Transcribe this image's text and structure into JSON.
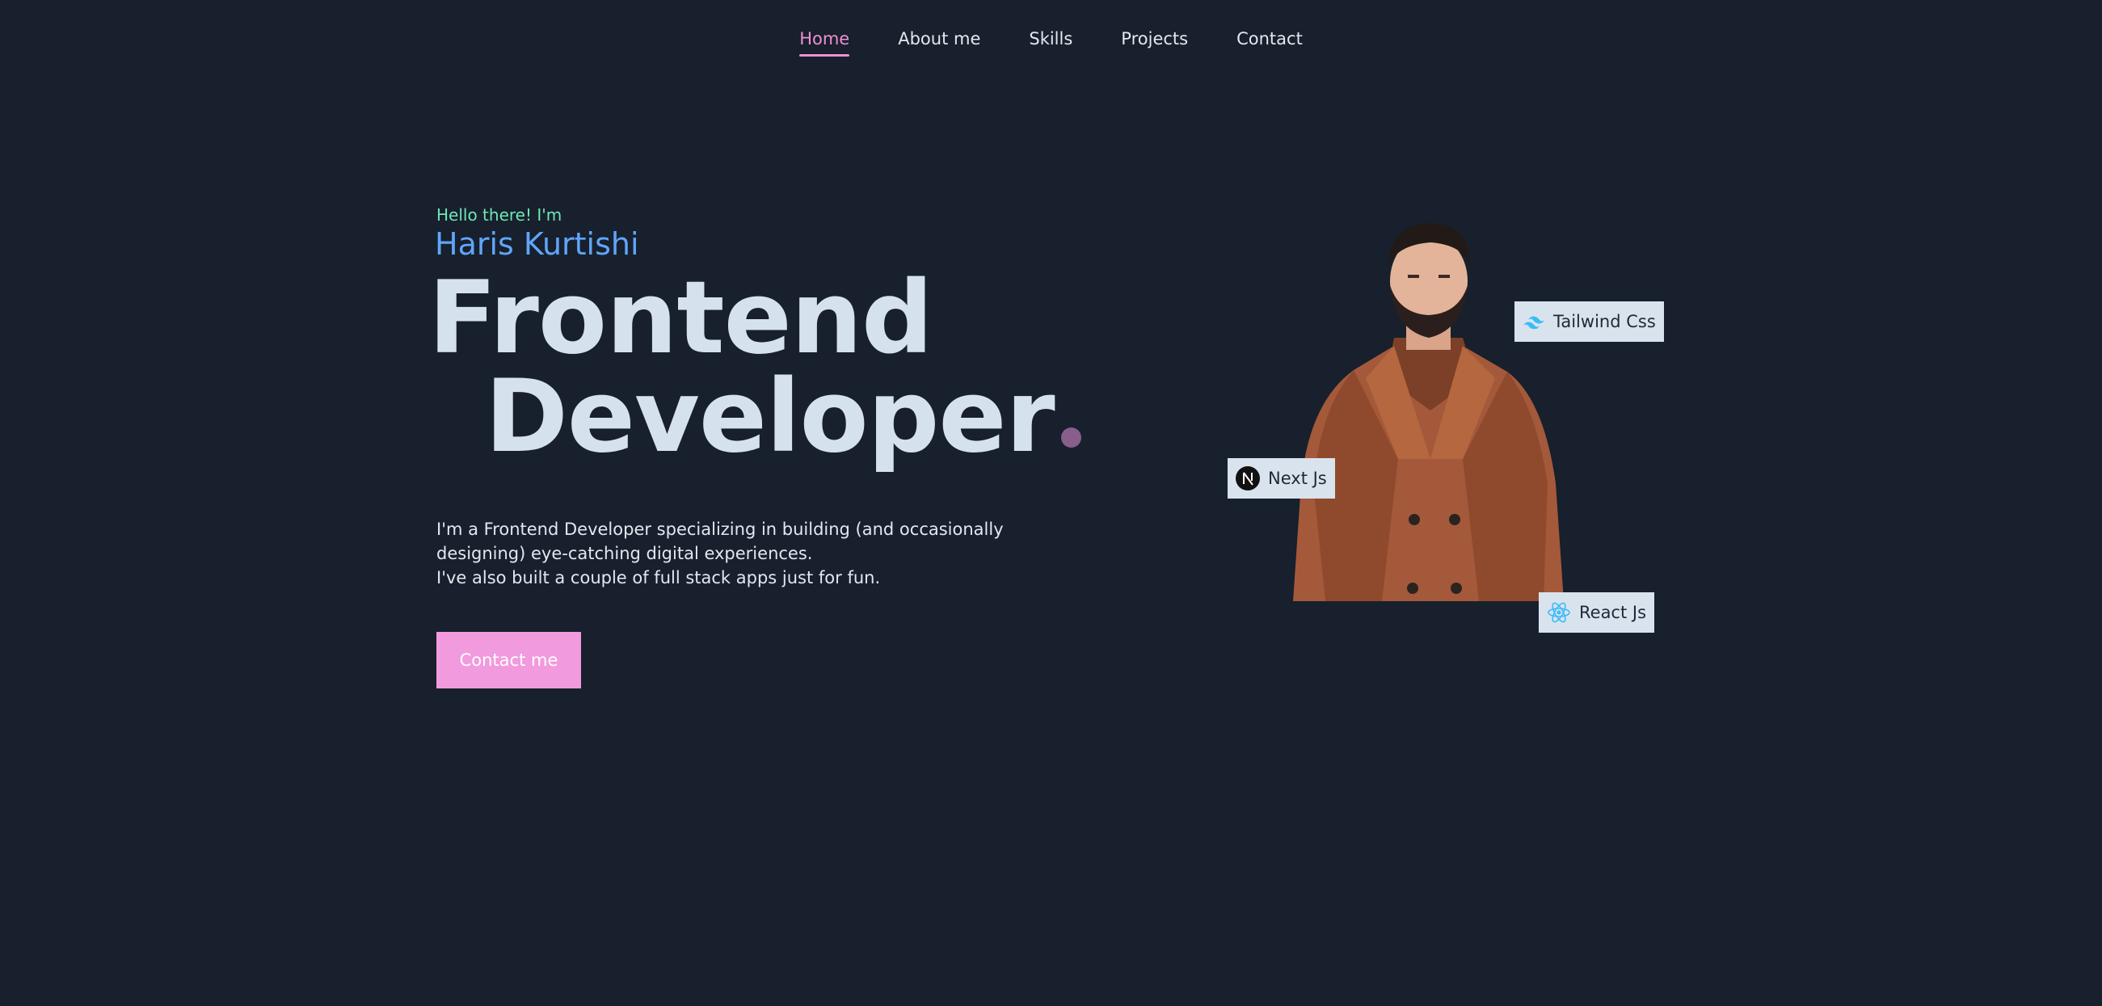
{
  "nav": {
    "items": [
      {
        "label": "Home",
        "active": true
      },
      {
        "label": "About me",
        "active": false
      },
      {
        "label": "Skills",
        "active": false
      },
      {
        "label": "Projects",
        "active": false
      },
      {
        "label": "Contact",
        "active": false
      }
    ]
  },
  "hero": {
    "greeting": "Hello there! I'm",
    "name": "Haris Kurtishi",
    "headline_line1": "Frontend",
    "headline_line2": "Developer",
    "intro_line1": "I'm a Frontend Developer specializing in building (and occasionally designing) eye-catching digital experiences.",
    "intro_line2": "I've also built a couple of full stack apps just for fun.",
    "cta_label": "Contact me"
  },
  "badges": {
    "tailwind": {
      "label": "Tailwind Css",
      "icon": "tailwind-icon"
    },
    "next": {
      "label": "Next Js",
      "icon": "nextjs-icon"
    },
    "react": {
      "label": "React Js",
      "icon": "react-icon"
    }
  },
  "colors": {
    "background": "#17202c",
    "accent_pink": "#f08fd6",
    "greeting_green": "#6ee7b7",
    "name_blue": "#60a5fa",
    "headline": "#d6e1ee",
    "button": "#f29ade"
  }
}
